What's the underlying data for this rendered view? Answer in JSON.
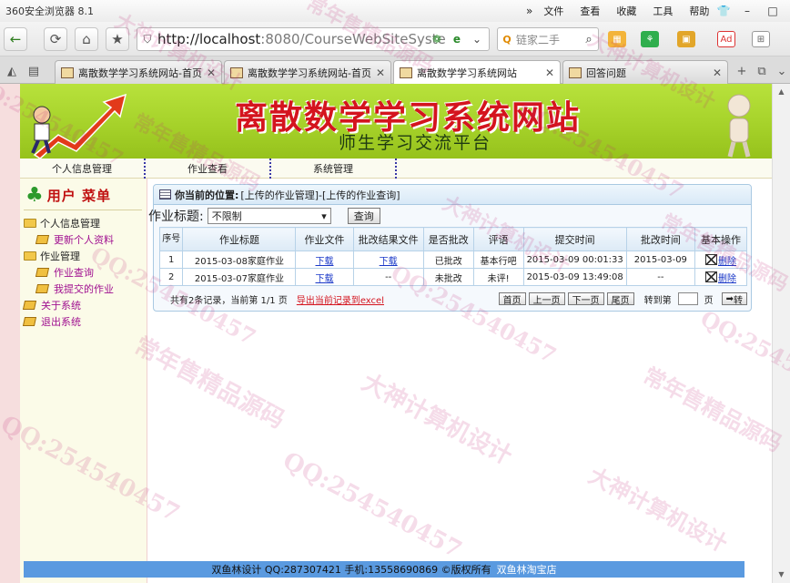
{
  "browser": {
    "app_title": "360安全浏览器 8.1",
    "menus": [
      "文件",
      "查看",
      "收藏",
      "工具",
      "帮助"
    ],
    "url_host": "http://localhost",
    "url_rest": ":8080/CourseWebSiteSyste",
    "search_placeholder": "链家二手",
    "ext_labels": [
      "Ad"
    ]
  },
  "tabs": [
    {
      "label": "离散数学学习系统网站-首页"
    },
    {
      "label": "离散数学学习系统网站-首页"
    },
    {
      "label": "离散数学学习系统网站"
    },
    {
      "label": "回答问题"
    }
  ],
  "banner": {
    "title": "离散数学学习系统网站",
    "subtitle": "师生学习交流平台"
  },
  "topnav": [
    "个人信息管理",
    "作业查看",
    "系统管理"
  ],
  "sidebar": {
    "title": "用户 菜单",
    "items": [
      {
        "label": "个人信息管理",
        "kind": "folder"
      },
      {
        "label": "更新个人资料",
        "kind": "leaf"
      },
      {
        "label": "作业管理",
        "kind": "folder"
      },
      {
        "label": "作业查询",
        "kind": "leaf"
      },
      {
        "label": "我提交的作业",
        "kind": "leaf"
      },
      {
        "label": "关于系统",
        "kind": "root"
      },
      {
        "label": "退出系统",
        "kind": "root"
      }
    ]
  },
  "location": {
    "label": "你当前的位置:",
    "path": "[上传的作业管理]-[上传的作业查询]"
  },
  "filter": {
    "label": "作业标题:",
    "selected": "不限制",
    "button": "查询"
  },
  "table": {
    "headers": [
      "序号",
      "作业标题",
      "作业文件",
      "批改结果文件",
      "是否批改",
      "评语",
      "提交时间",
      "批改时间",
      "基本操作"
    ],
    "rows": [
      {
        "no": "1",
        "title": "2015-03-08家庭作业",
        "file": "下载",
        "result": "下载",
        "status": "已批改",
        "comment": "基本行吧",
        "submit": "2015-03-09 00:01:33",
        "graded": "2015-03-09",
        "op": "删除"
      },
      {
        "no": "2",
        "title": "2015-03-07家庭作业",
        "file": "下载",
        "result": "--",
        "status": "未批改",
        "comment": "未评!",
        "submit": "2015-03-09 13:49:08",
        "graded": "--",
        "op": "删除"
      }
    ]
  },
  "pager": {
    "count": "共有2条记录，当前第 1/1 页",
    "export": "导出当前记录到excel",
    "first": "首页",
    "prev": "上一页",
    "next": "下一页",
    "last": "尾页",
    "jump_label": "转到第",
    "page_unit": "页",
    "go": "转"
  },
  "footer": {
    "text": "双鱼林设计 QQ:287307421 手机:13558690869 ©版权所有",
    "link": "双鱼林淘宝店"
  },
  "watermarks": {
    "brand": "常年售精品源码",
    "qq": "QQ:254540457",
    "design": "大神计算机设计"
  },
  "colors": {
    "banner_green": "#a6d22a",
    "title_red": "#d4141e",
    "footer_blue": "#5a9ae0",
    "link_blue": "#1a38c8",
    "sidebar_purple": "#a01090"
  }
}
